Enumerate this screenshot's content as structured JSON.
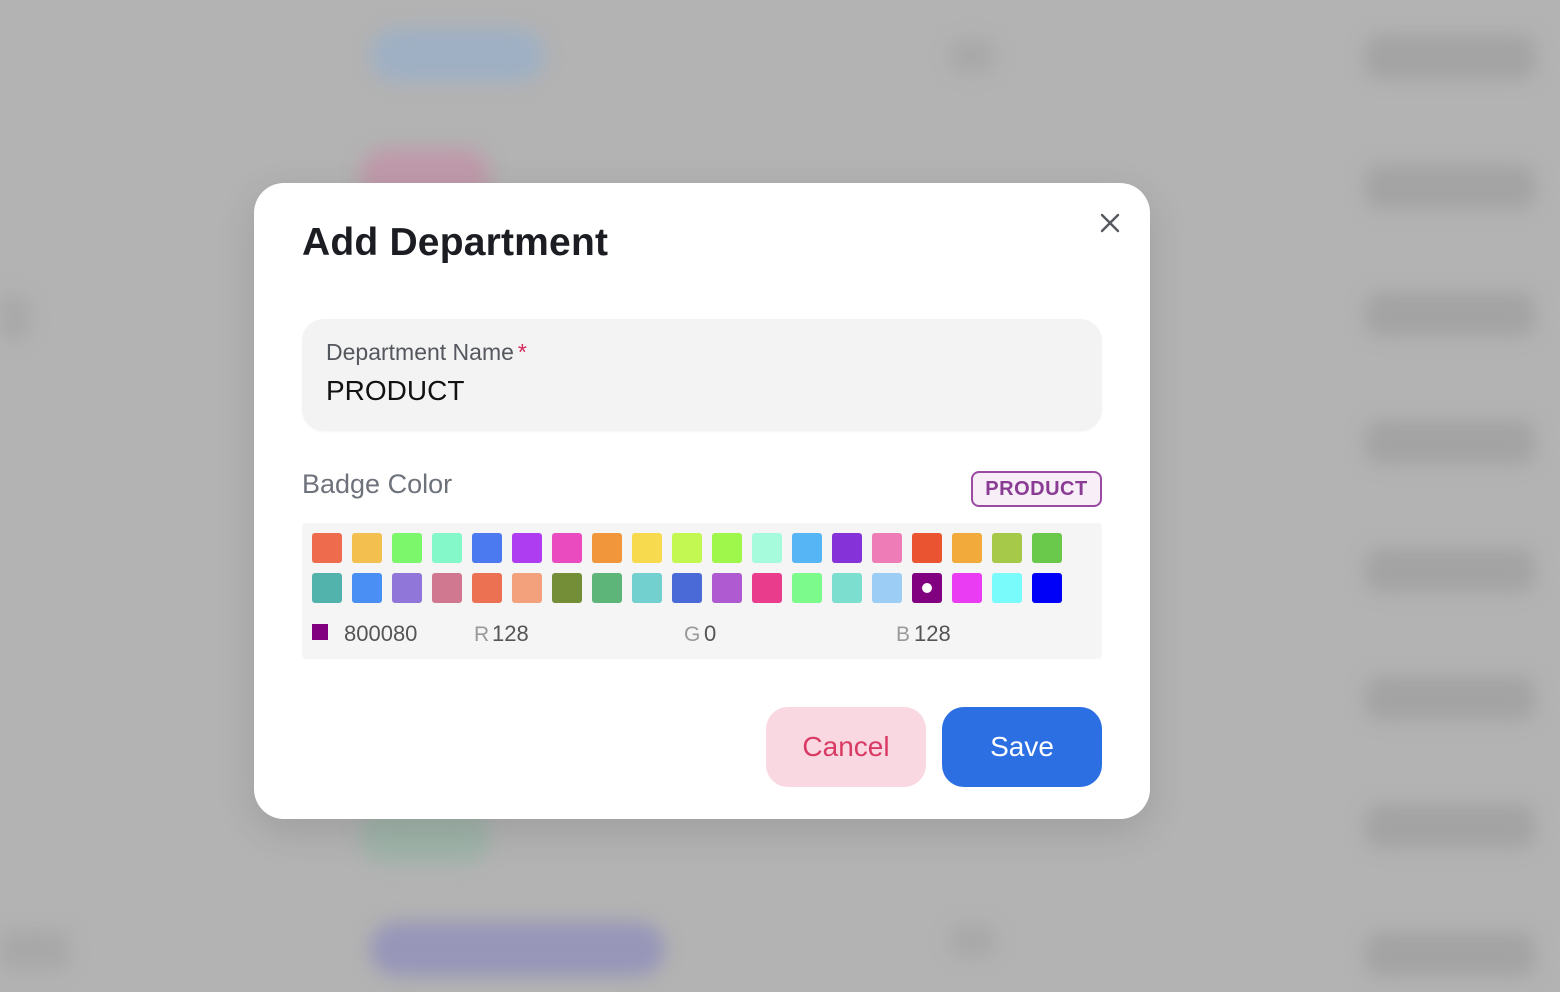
{
  "modal": {
    "title": "Add Department",
    "close_icon": "close-icon"
  },
  "department_name": {
    "label": "Department Name",
    "required_mark": "*",
    "value": "PRODUCT"
  },
  "badge": {
    "label": "Badge Color",
    "preview_text": "PRODUCT",
    "preview_border_color": "#9b4aa4",
    "preview_text_color": "#8a3c94"
  },
  "color_picker": {
    "swatches": [
      "#ee6b4d",
      "#f3bf4f",
      "#7cf76c",
      "#84f8c8",
      "#4b79ef",
      "#ae3df2",
      "#ea4cc0",
      "#f2963c",
      "#f8da4e",
      "#c3f852",
      "#9ef74a",
      "#a6fbdd",
      "#56b5f5",
      "#8533d9",
      "#ee7cb6",
      "#eb5430",
      "#f2aa3b",
      "#a6c94a",
      "#6ac84a",
      "#52b3ac",
      "#4a8ff3",
      "#9176da",
      "#d0788f",
      "#ec7052",
      "#f2a17c",
      "#738e37",
      "#5db57a",
      "#72d0cf",
      "#4a6ad8",
      "#b05ad1",
      "#ea3c8c",
      "#7dfa8c",
      "#7cdecf",
      "#9ccdf4",
      "#800080",
      "#ea3cf3",
      "#79fbfb",
      "#0000f8"
    ],
    "selected_index": 34,
    "hex_value": "800080",
    "hex_color": "#800080",
    "r_label": "R",
    "r_value": "128",
    "g_label": "G",
    "g_value": "0",
    "b_label": "B",
    "b_value": "128"
  },
  "actions": {
    "cancel_label": "Cancel",
    "save_label": "Save"
  }
}
